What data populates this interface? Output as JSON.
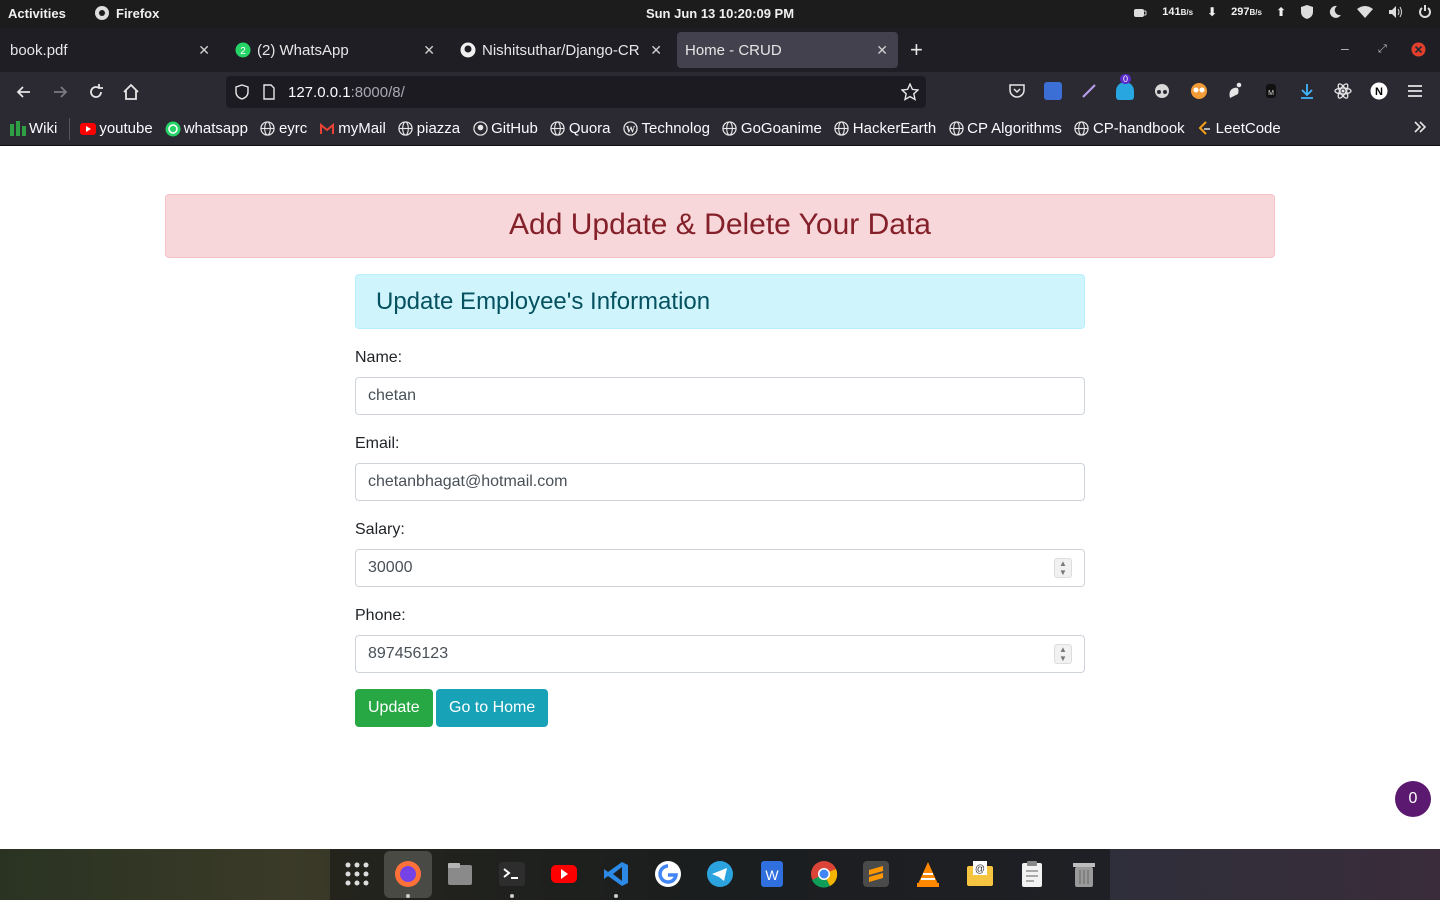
{
  "topbar": {
    "activities": "Activities",
    "app_name": "Firefox",
    "clock": "Sun Jun 13  10:20:09 PM",
    "net_down": "141",
    "net_down_unit": "B/s",
    "net_up": "297",
    "net_up_unit": "B/s"
  },
  "tabs": [
    {
      "label": "book.pdf"
    },
    {
      "label": "(2) WhatsApp"
    },
    {
      "label": "Nishitsuthar/Django-CR"
    },
    {
      "label": "Home - CRUD"
    }
  ],
  "url": {
    "host": "127.0.0.1",
    "path": ":8000/8/"
  },
  "bookmarks": [
    {
      "label": "Wiki"
    },
    {
      "label": "youtube"
    },
    {
      "label": "whatsapp"
    },
    {
      "label": "eyrc"
    },
    {
      "label": "myMail"
    },
    {
      "label": "piazza"
    },
    {
      "label": "GitHub"
    },
    {
      "label": "Quora"
    },
    {
      "label": "Technolog"
    },
    {
      "label": "GoGoanime"
    },
    {
      "label": "HackerEarth"
    },
    {
      "label": "CP Algorithms"
    },
    {
      "label": "CP-handbook"
    },
    {
      "label": "LeetCode"
    }
  ],
  "extensions": {
    "badge_count": "0"
  },
  "page": {
    "banner": "Add Update & Delete Your Data",
    "form_title": "Update Employee's Information",
    "name_label": "Name:",
    "name_value": "chetan",
    "email_label": "Email:",
    "email_value": "chetanbhagat@hotmail.com",
    "salary_label": "Salary:",
    "salary_value": "30000",
    "phone_label": "Phone:",
    "phone_value": "897456123",
    "update_button": "Update",
    "home_button": "Go to Home",
    "chat_count": "0"
  },
  "colors": {
    "danger_bg": "#f8d7da",
    "danger_text": "#842029",
    "info_bg": "#cff4fc",
    "info_text": "#055160",
    "success": "#28a745",
    "info_button": "#17a2b8"
  }
}
